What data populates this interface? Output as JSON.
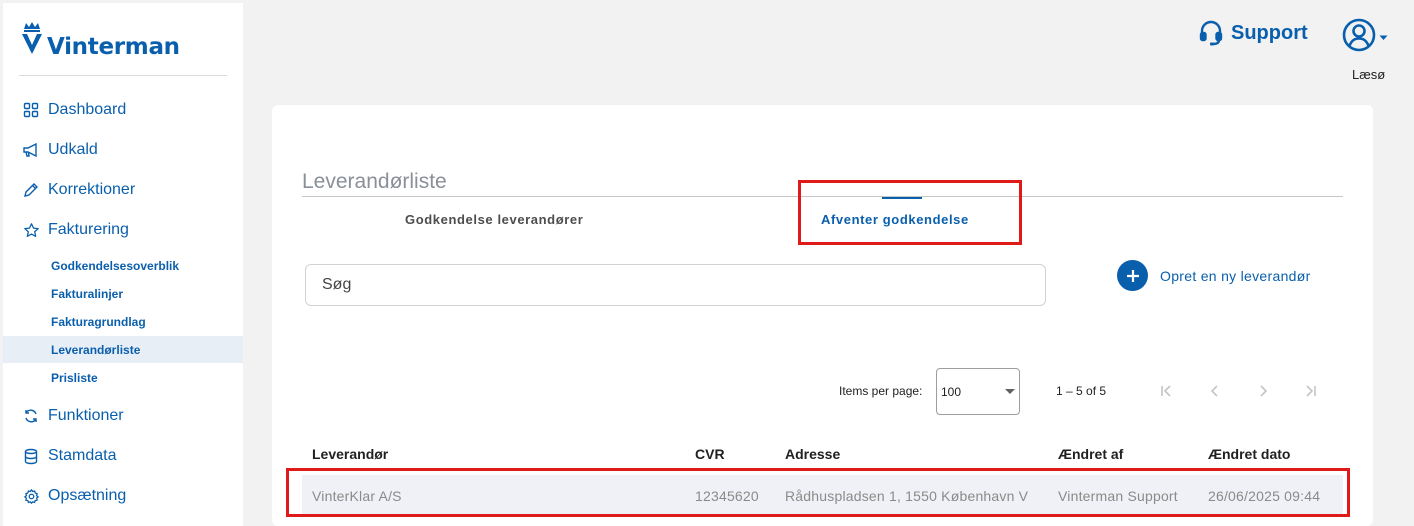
{
  "brand": {
    "name": "Vinterman",
    "logo_icon": "crown-v-logo-icon"
  },
  "sidebar": {
    "items": [
      {
        "label": "Dashboard",
        "icon": "grid-icon"
      },
      {
        "label": "Udkald",
        "icon": "megaphone-icon"
      },
      {
        "label": "Korrektioner",
        "icon": "pencil-icon"
      },
      {
        "label": "Fakturering",
        "icon": "star-icon"
      },
      {
        "label": "Funktioner",
        "icon": "refresh-icon"
      },
      {
        "label": "Stamdata",
        "icon": "database-icon"
      },
      {
        "label": "Opsætning",
        "icon": "gear-icon"
      }
    ],
    "sub_items": [
      {
        "label": "Godkendelsesoverblik"
      },
      {
        "label": "Fakturalinjer"
      },
      {
        "label": "Fakturagrundlag"
      },
      {
        "label": "Leverandørliste",
        "active": true
      },
      {
        "label": "Prisliste"
      }
    ]
  },
  "header": {
    "support_label": "Support",
    "username": "Læsø"
  },
  "main": {
    "title": "Leverandørliste",
    "tabs": [
      {
        "label": "Godkendelse leverandører",
        "active": false
      },
      {
        "label": "Afventer godkendelse",
        "active": true
      }
    ],
    "search": {
      "placeholder": "Søg",
      "value": ""
    },
    "create_label": "Opret en ny leverandør",
    "paginator": {
      "items_per_page_label": "Items per page:",
      "items_per_page_value": "100",
      "range_label": "1 – 5 of 5"
    },
    "table": {
      "columns": [
        "Leverandør",
        "CVR",
        "Adresse",
        "Ændret af",
        "Ændret dato"
      ],
      "rows": [
        [
          "VinterKlar A/S",
          "12345620",
          "Rådhuspladsen 1, 1550 København V",
          "Vinterman Support",
          "26/06/2025 09:44"
        ]
      ]
    }
  },
  "colors": {
    "primary": "#0a5fad",
    "highlight": "#e01919",
    "background": "#f2f2f2"
  }
}
